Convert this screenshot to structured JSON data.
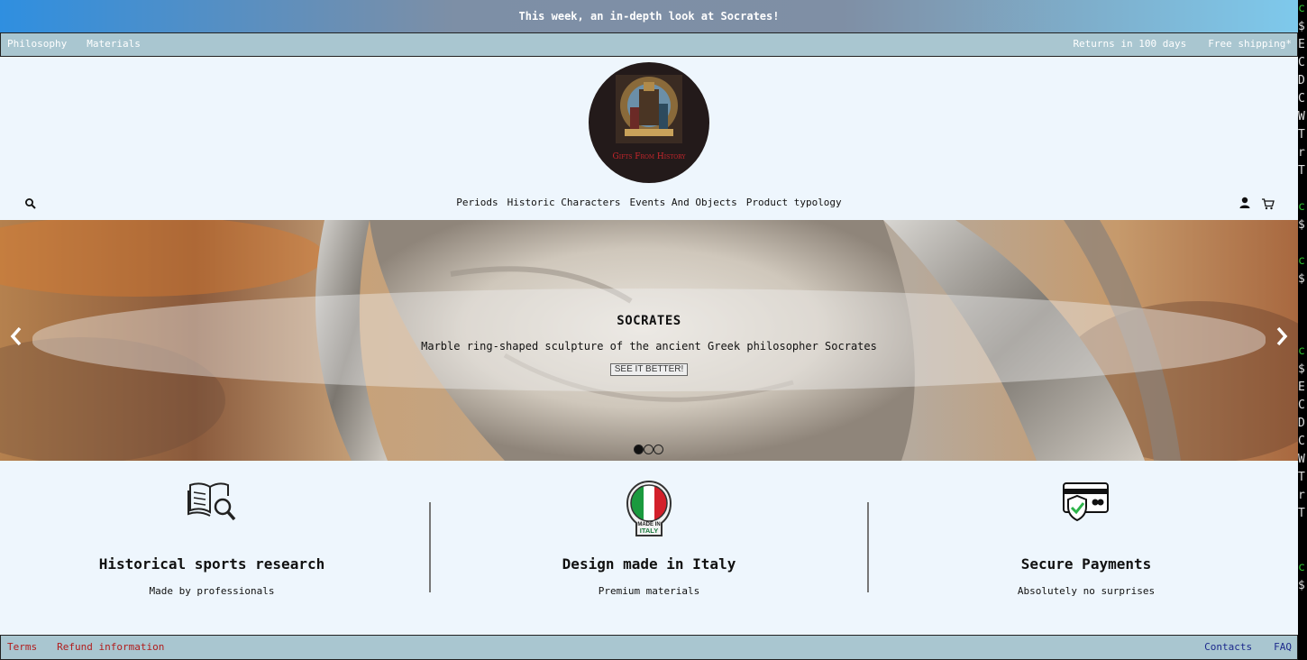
{
  "announcement": "This week, an in-depth look at Socrates!",
  "topbar": {
    "left": [
      "Philosophy",
      "Materials"
    ],
    "right": [
      "Returns in 100 days",
      "Free shipping*"
    ]
  },
  "logo": {
    "brand": "Gifts From History"
  },
  "nav": [
    "Periods",
    "Historic Characters",
    "Events And Objects",
    "Product typology"
  ],
  "icons": {
    "search": "search-icon",
    "user": "user-icon",
    "cart": "cart-icon"
  },
  "hero": {
    "title": "SOCRATES",
    "description": "Marble ring-shaped sculpture of the ancient Greek philosopher Socrates",
    "button": "SEE IT BETTER!",
    "slides_total": 3,
    "active_slide": 1
  },
  "features": [
    {
      "icon": "book-search-icon",
      "title": "Historical sports research",
      "subtitle": "Made by professionals"
    },
    {
      "icon": "made-in-italy-badge-icon",
      "title": "Design made in Italy",
      "subtitle": "Premium materials",
      "badge_text": "MADE IN ITALY"
    },
    {
      "icon": "secure-card-icon",
      "title": "Secure Payments",
      "subtitle": "Absolutely no surprises"
    }
  ],
  "footer": {
    "left": [
      "Terms",
      "Refund information"
    ],
    "right": [
      "Contacts",
      "FAQ"
    ]
  },
  "colors": {
    "topbar_bg": "#a9c6d0",
    "page_bg": "#eef6fd",
    "footer_left_link": "#b11d1d",
    "footer_right_link": "#1c2a8c"
  },
  "terminal_strip": [
    "c",
    "$",
    "E",
    "C",
    "D",
    "C",
    "W",
    "T",
    "r",
    "T",
    "",
    "c",
    "$",
    "",
    "c",
    "$",
    "",
    "",
    "",
    "c",
    "$",
    "E",
    "C",
    "D",
    "C",
    "W",
    "T",
    "r",
    "T",
    "",
    "",
    "c",
    "$"
  ]
}
